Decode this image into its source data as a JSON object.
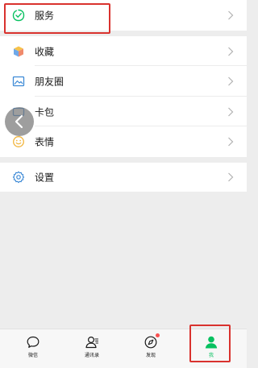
{
  "colors": {
    "background": "#ededed",
    "accent": "#07c160",
    "annotation": "#d9322e",
    "badge": "#fa5151"
  },
  "menu": {
    "service": {
      "label": "服务",
      "icon": "service-check-icon"
    },
    "items": [
      {
        "label": "收藏",
        "icon": "favorites-cube-icon"
      },
      {
        "label": "朋友圈",
        "icon": "moments-photo-icon"
      },
      {
        "label": "卡包",
        "icon": "card-wallet-icon"
      },
      {
        "label": "表情",
        "icon": "sticker-smile-icon"
      }
    ],
    "settings": {
      "label": "设置",
      "icon": "gear-icon"
    }
  },
  "back_button": {
    "icon": "chevron-left-icon"
  },
  "tabbar": {
    "tabs": [
      {
        "label": "微信",
        "icon": "chat-bubble-icon"
      },
      {
        "label": "通讯录",
        "icon": "contacts-icon"
      },
      {
        "label": "发现",
        "icon": "compass-icon"
      },
      {
        "label": "我",
        "icon": "person-icon"
      }
    ],
    "active": "我"
  }
}
